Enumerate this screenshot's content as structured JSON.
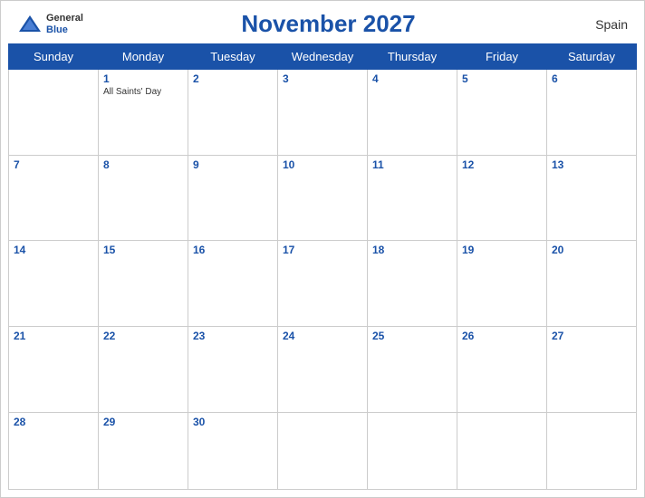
{
  "header": {
    "title": "November 2027",
    "country": "Spain",
    "logo": {
      "general": "General",
      "blue": "Blue"
    }
  },
  "days_of_week": [
    "Sunday",
    "Monday",
    "Tuesday",
    "Wednesday",
    "Thursday",
    "Friday",
    "Saturday"
  ],
  "weeks": [
    [
      {
        "day": "",
        "empty": true
      },
      {
        "day": "1",
        "event": "All Saints' Day"
      },
      {
        "day": "2",
        "event": ""
      },
      {
        "day": "3",
        "event": ""
      },
      {
        "day": "4",
        "event": ""
      },
      {
        "day": "5",
        "event": ""
      },
      {
        "day": "6",
        "event": ""
      }
    ],
    [
      {
        "day": "7",
        "event": ""
      },
      {
        "day": "8",
        "event": ""
      },
      {
        "day": "9",
        "event": ""
      },
      {
        "day": "10",
        "event": ""
      },
      {
        "day": "11",
        "event": ""
      },
      {
        "day": "12",
        "event": ""
      },
      {
        "day": "13",
        "event": ""
      }
    ],
    [
      {
        "day": "14",
        "event": ""
      },
      {
        "day": "15",
        "event": ""
      },
      {
        "day": "16",
        "event": ""
      },
      {
        "day": "17",
        "event": ""
      },
      {
        "day": "18",
        "event": ""
      },
      {
        "day": "19",
        "event": ""
      },
      {
        "day": "20",
        "event": ""
      }
    ],
    [
      {
        "day": "21",
        "event": ""
      },
      {
        "day": "22",
        "event": ""
      },
      {
        "day": "23",
        "event": ""
      },
      {
        "day": "24",
        "event": ""
      },
      {
        "day": "25",
        "event": ""
      },
      {
        "day": "26",
        "event": ""
      },
      {
        "day": "27",
        "event": ""
      }
    ],
    [
      {
        "day": "28",
        "event": ""
      },
      {
        "day": "29",
        "event": ""
      },
      {
        "day": "30",
        "event": ""
      },
      {
        "day": "",
        "empty": true
      },
      {
        "day": "",
        "empty": true
      },
      {
        "day": "",
        "empty": true
      },
      {
        "day": "",
        "empty": true
      }
    ]
  ],
  "colors": {
    "header_bg": "#1a52a8",
    "accent": "#1a52a8"
  }
}
